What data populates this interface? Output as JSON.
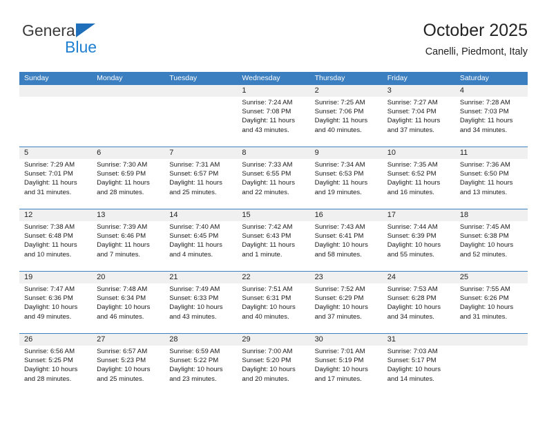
{
  "brand": {
    "name_top": "General",
    "name_bottom": "Blue",
    "triangle_icon": "triangle-icon",
    "accent_color": "#1f7fd0",
    "triangle_color": "#1f6fba"
  },
  "header": {
    "title": "October 2025",
    "subtitle": "Canelli, Piedmont, Italy"
  },
  "theme": {
    "header_row_bg": "#3c7fc1",
    "header_row_text": "#ffffff",
    "day_number_bg": "#f0f0f0",
    "row_divider": "#3c7fc1"
  },
  "calendar": {
    "weekdays": [
      "Sunday",
      "Monday",
      "Tuesday",
      "Wednesday",
      "Thursday",
      "Friday",
      "Saturday"
    ],
    "labels": {
      "sunrise": "Sunrise:",
      "sunset": "Sunset:",
      "daylight": "Daylight:"
    },
    "weeks": [
      [
        {
          "empty": true
        },
        {
          "empty": true
        },
        {
          "empty": true
        },
        {
          "day": "1",
          "sunrise": "Sunrise: 7:24 AM",
          "sunset": "Sunset: 7:08 PM",
          "daylight": "Daylight: 11 hours and 43 minutes."
        },
        {
          "day": "2",
          "sunrise": "Sunrise: 7:25 AM",
          "sunset": "Sunset: 7:06 PM",
          "daylight": "Daylight: 11 hours and 40 minutes."
        },
        {
          "day": "3",
          "sunrise": "Sunrise: 7:27 AM",
          "sunset": "Sunset: 7:04 PM",
          "daylight": "Daylight: 11 hours and 37 minutes."
        },
        {
          "day": "4",
          "sunrise": "Sunrise: 7:28 AM",
          "sunset": "Sunset: 7:03 PM",
          "daylight": "Daylight: 11 hours and 34 minutes."
        }
      ],
      [
        {
          "day": "5",
          "sunrise": "Sunrise: 7:29 AM",
          "sunset": "Sunset: 7:01 PM",
          "daylight": "Daylight: 11 hours and 31 minutes."
        },
        {
          "day": "6",
          "sunrise": "Sunrise: 7:30 AM",
          "sunset": "Sunset: 6:59 PM",
          "daylight": "Daylight: 11 hours and 28 minutes."
        },
        {
          "day": "7",
          "sunrise": "Sunrise: 7:31 AM",
          "sunset": "Sunset: 6:57 PM",
          "daylight": "Daylight: 11 hours and 25 minutes."
        },
        {
          "day": "8",
          "sunrise": "Sunrise: 7:33 AM",
          "sunset": "Sunset: 6:55 PM",
          "daylight": "Daylight: 11 hours and 22 minutes."
        },
        {
          "day": "9",
          "sunrise": "Sunrise: 7:34 AM",
          "sunset": "Sunset: 6:53 PM",
          "daylight": "Daylight: 11 hours and 19 minutes."
        },
        {
          "day": "10",
          "sunrise": "Sunrise: 7:35 AM",
          "sunset": "Sunset: 6:52 PM",
          "daylight": "Daylight: 11 hours and 16 minutes."
        },
        {
          "day": "11",
          "sunrise": "Sunrise: 7:36 AM",
          "sunset": "Sunset: 6:50 PM",
          "daylight": "Daylight: 11 hours and 13 minutes."
        }
      ],
      [
        {
          "day": "12",
          "sunrise": "Sunrise: 7:38 AM",
          "sunset": "Sunset: 6:48 PM",
          "daylight": "Daylight: 11 hours and 10 minutes."
        },
        {
          "day": "13",
          "sunrise": "Sunrise: 7:39 AM",
          "sunset": "Sunset: 6:46 PM",
          "daylight": "Daylight: 11 hours and 7 minutes."
        },
        {
          "day": "14",
          "sunrise": "Sunrise: 7:40 AM",
          "sunset": "Sunset: 6:45 PM",
          "daylight": "Daylight: 11 hours and 4 minutes."
        },
        {
          "day": "15",
          "sunrise": "Sunrise: 7:42 AM",
          "sunset": "Sunset: 6:43 PM",
          "daylight": "Daylight: 11 hours and 1 minute."
        },
        {
          "day": "16",
          "sunrise": "Sunrise: 7:43 AM",
          "sunset": "Sunset: 6:41 PM",
          "daylight": "Daylight: 10 hours and 58 minutes."
        },
        {
          "day": "17",
          "sunrise": "Sunrise: 7:44 AM",
          "sunset": "Sunset: 6:39 PM",
          "daylight": "Daylight: 10 hours and 55 minutes."
        },
        {
          "day": "18",
          "sunrise": "Sunrise: 7:45 AM",
          "sunset": "Sunset: 6:38 PM",
          "daylight": "Daylight: 10 hours and 52 minutes."
        }
      ],
      [
        {
          "day": "19",
          "sunrise": "Sunrise: 7:47 AM",
          "sunset": "Sunset: 6:36 PM",
          "daylight": "Daylight: 10 hours and 49 minutes."
        },
        {
          "day": "20",
          "sunrise": "Sunrise: 7:48 AM",
          "sunset": "Sunset: 6:34 PM",
          "daylight": "Daylight: 10 hours and 46 minutes."
        },
        {
          "day": "21",
          "sunrise": "Sunrise: 7:49 AM",
          "sunset": "Sunset: 6:33 PM",
          "daylight": "Daylight: 10 hours and 43 minutes."
        },
        {
          "day": "22",
          "sunrise": "Sunrise: 7:51 AM",
          "sunset": "Sunset: 6:31 PM",
          "daylight": "Daylight: 10 hours and 40 minutes."
        },
        {
          "day": "23",
          "sunrise": "Sunrise: 7:52 AM",
          "sunset": "Sunset: 6:29 PM",
          "daylight": "Daylight: 10 hours and 37 minutes."
        },
        {
          "day": "24",
          "sunrise": "Sunrise: 7:53 AM",
          "sunset": "Sunset: 6:28 PM",
          "daylight": "Daylight: 10 hours and 34 minutes."
        },
        {
          "day": "25",
          "sunrise": "Sunrise: 7:55 AM",
          "sunset": "Sunset: 6:26 PM",
          "daylight": "Daylight: 10 hours and 31 minutes."
        }
      ],
      [
        {
          "day": "26",
          "sunrise": "Sunrise: 6:56 AM",
          "sunset": "Sunset: 5:25 PM",
          "daylight": "Daylight: 10 hours and 28 minutes."
        },
        {
          "day": "27",
          "sunrise": "Sunrise: 6:57 AM",
          "sunset": "Sunset: 5:23 PM",
          "daylight": "Daylight: 10 hours and 25 minutes."
        },
        {
          "day": "28",
          "sunrise": "Sunrise: 6:59 AM",
          "sunset": "Sunset: 5:22 PM",
          "daylight": "Daylight: 10 hours and 23 minutes."
        },
        {
          "day": "29",
          "sunrise": "Sunrise: 7:00 AM",
          "sunset": "Sunset: 5:20 PM",
          "daylight": "Daylight: 10 hours and 20 minutes."
        },
        {
          "day": "30",
          "sunrise": "Sunrise: 7:01 AM",
          "sunset": "Sunset: 5:19 PM",
          "daylight": "Daylight: 10 hours and 17 minutes."
        },
        {
          "day": "31",
          "sunrise": "Sunrise: 7:03 AM",
          "sunset": "Sunset: 5:17 PM",
          "daylight": "Daylight: 10 hours and 14 minutes."
        },
        {
          "empty": true
        }
      ]
    ]
  }
}
